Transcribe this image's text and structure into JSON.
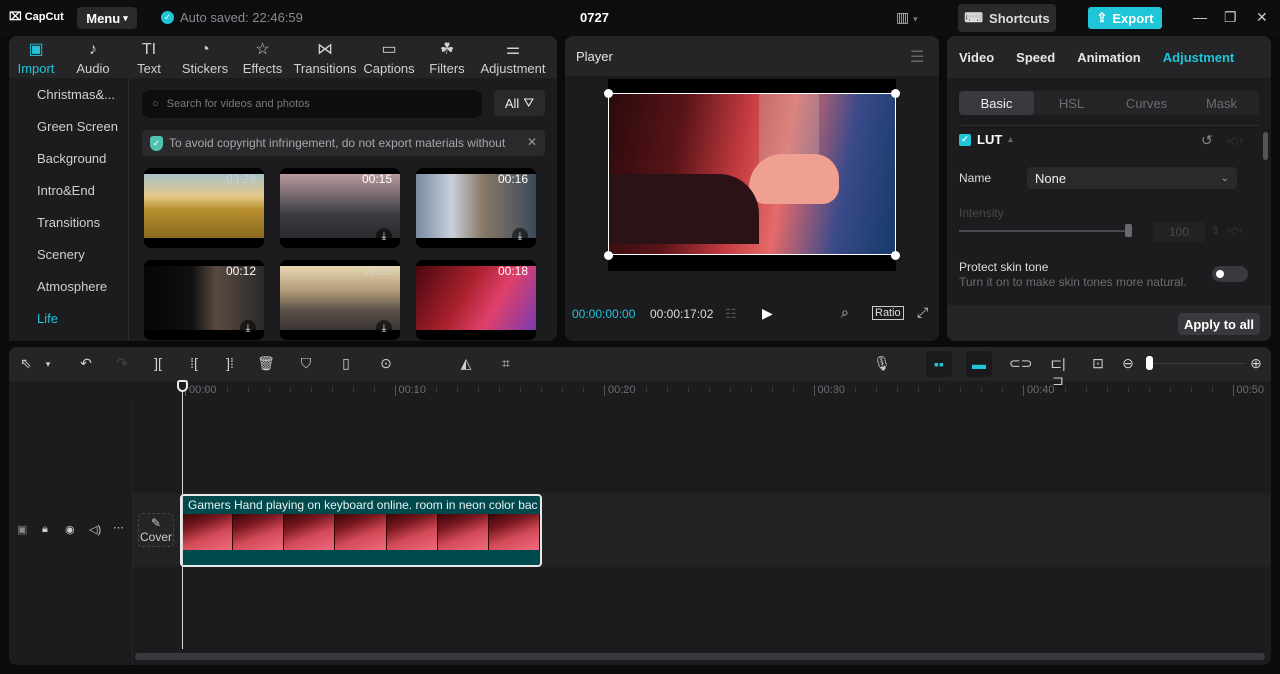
{
  "app": {
    "name": "CapCut",
    "menu_label": "Menu",
    "autosave": "Auto saved: 22:46:59",
    "project_title": "0727",
    "shortcuts_label": "Shortcuts",
    "export_label": "Export"
  },
  "media_tabs": [
    {
      "label": "Import",
      "icon": "import-icon",
      "glyph": "▣",
      "active": true
    },
    {
      "label": "Audio",
      "icon": "audio-icon",
      "glyph": "♪"
    },
    {
      "label": "Text",
      "icon": "text-icon",
      "glyph": "TI"
    },
    {
      "label": "Stickers",
      "icon": "sticker-icon",
      "glyph": "◔"
    },
    {
      "label": "Effects",
      "icon": "effects-icon",
      "glyph": "☆"
    },
    {
      "label": "Transitions",
      "icon": "transitions-icon",
      "glyph": "⋈"
    },
    {
      "label": "Captions",
      "icon": "captions-icon",
      "glyph": "▭"
    },
    {
      "label": "Filters",
      "icon": "filters-icon",
      "glyph": "☘"
    },
    {
      "label": "Adjustment",
      "icon": "adjustment-icon",
      "glyph": "⚌"
    }
  ],
  "categories": [
    "Christmas&...",
    "Green Screen",
    "Background",
    "Intro&End",
    "Transitions",
    "Scenery",
    "Atmosphere",
    "Life"
  ],
  "active_category": "Life",
  "search": {
    "placeholder": "Search for videos and photos",
    "value": ""
  },
  "filter_label": "All",
  "notice": "To avoid copyright infringement, do not export materials without",
  "thumbnails": [
    {
      "duration": "03:28",
      "subject": "woman in wheat field",
      "downloadable": false,
      "bg": "linear-gradient(180deg,#a8c0c8 0%,#e6c88a 35%,#b8902e 55%,#8a6a20 100%)"
    },
    {
      "duration": "00:15",
      "subject": "motorcyclists on road",
      "downloadable": true,
      "bg": "linear-gradient(180deg,#b89a9a 0%,#6a6068 40%,#3a3a40 65%,#2a2a2e 100%)"
    },
    {
      "duration": "00:16",
      "subject": "woman in city night",
      "downloadable": true,
      "bg": "linear-gradient(90deg,#7a8aa0 0%,#c8d0da 30%,#8a7a6a 55%,#3a4a5a 100%)"
    },
    {
      "duration": "00:12",
      "subject": "person with laptop",
      "downloadable": true,
      "bg": "linear-gradient(90deg,#050505 0%,#101010 40%,#5a4a40 60%,#2a2a2a 100%)"
    },
    {
      "duration": "00:23",
      "subject": "skateboarder at sunset",
      "downloadable": true,
      "bg": "linear-gradient(180deg,#e8d8b0 0%,#b09878 40%,#5a5048 70%,#3a3432 100%)"
    },
    {
      "duration": "00:18",
      "subject": "gamer hand on mouse",
      "downloadable": false,
      "bg": "linear-gradient(120deg,#4a0810 0%,#a8202c 40%,#e0406a 65%,#7a3ab0 100%)"
    }
  ],
  "player": {
    "title": "Player",
    "current_time": "00:00:00:00",
    "total_time": "00:00:17:02",
    "ratio_label": "Ratio"
  },
  "inspector": {
    "tabs": [
      "Video",
      "Speed",
      "Animation",
      "Adjustment"
    ],
    "active_tab": "Adjustment",
    "subtabs": [
      "Basic",
      "HSL",
      "Curves",
      "Mask"
    ],
    "active_subtab": "Basic",
    "lut": {
      "label": "LUT",
      "enabled": true,
      "name_label": "Name",
      "name_value": "None",
      "intensity_label": "Intensity",
      "intensity_value": "100",
      "intensity_fraction": 1.0
    },
    "protect_skin": {
      "label": "Protect skin tone",
      "description": "Turn it on to make skin tones more natural.",
      "enabled": false
    },
    "apply_all_label": "Apply to all"
  },
  "timeline": {
    "ruler_labels": [
      "00:00",
      "00:10",
      "00:20",
      "00:30",
      "00:40",
      "00:50"
    ],
    "cover_label": "Cover",
    "clip_title": "Gamers Hand playing on keyboard online. room  in neon color bac",
    "zoom_fraction": 0.02
  }
}
